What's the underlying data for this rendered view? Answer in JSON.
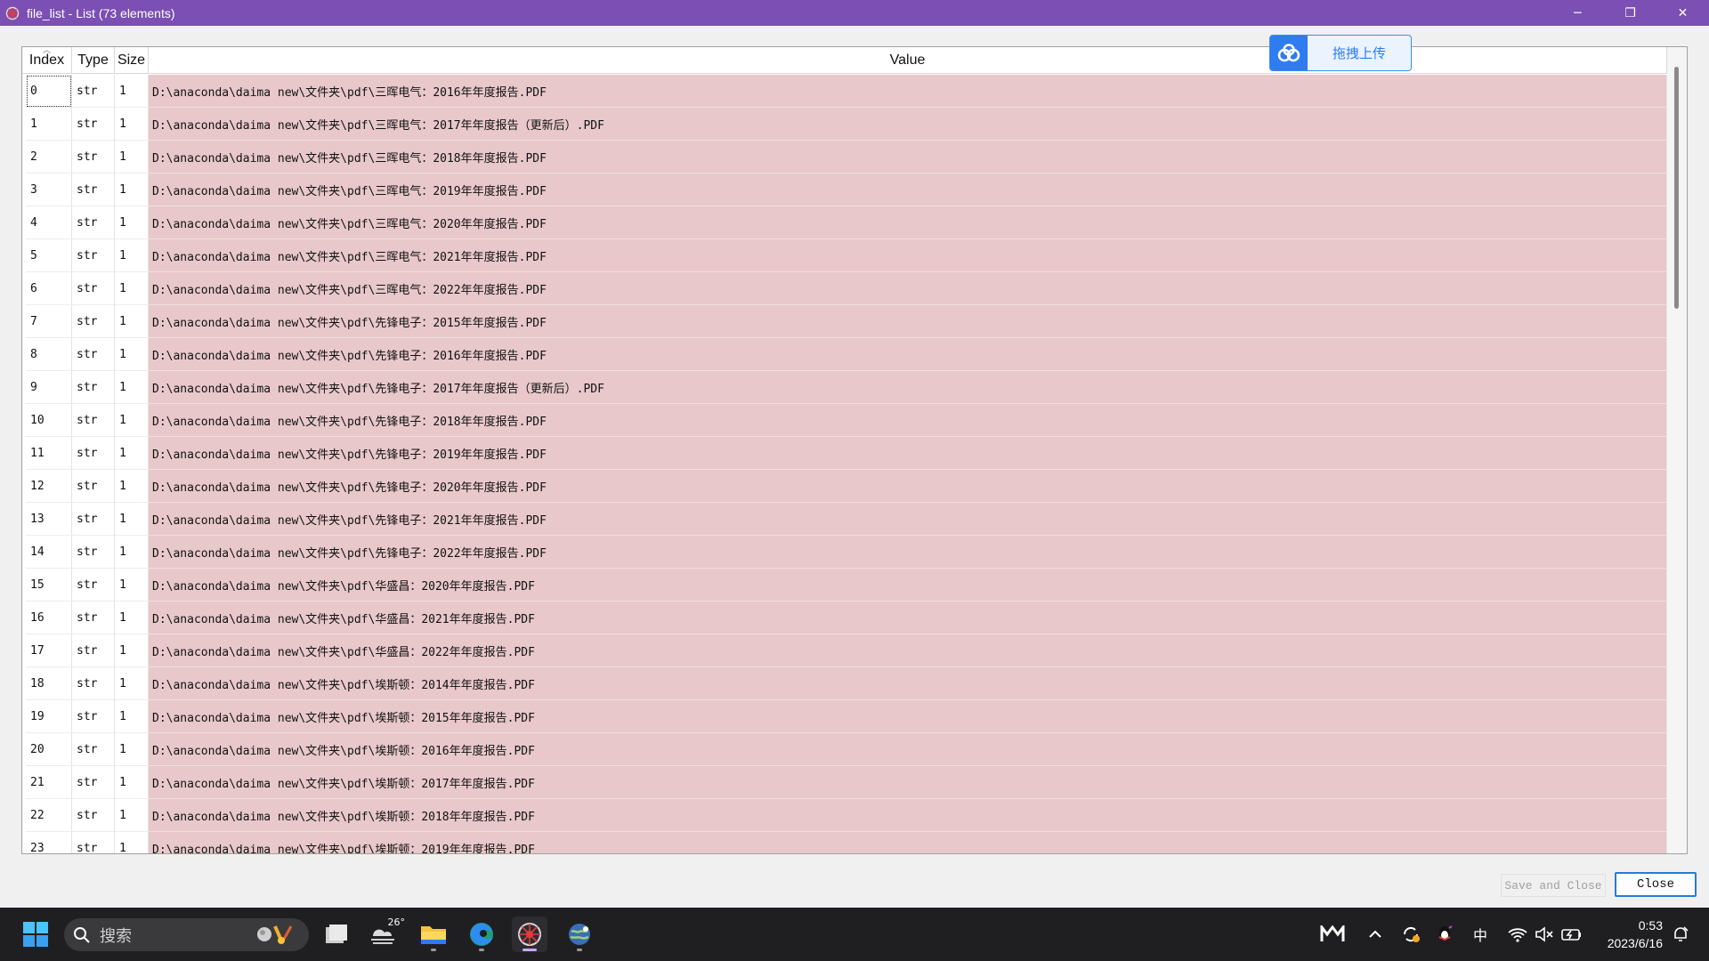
{
  "window": {
    "title": "file_list - List (73 elements)",
    "controls": {
      "minimize": "─",
      "restore": "❐",
      "close": "✕"
    }
  },
  "table": {
    "headers": {
      "index": "Index",
      "type": "Type",
      "size": "Size",
      "value": "Value"
    },
    "rows": [
      {
        "index": "0",
        "type": "str",
        "size": "1",
        "value": "D:\\anaconda\\daima new\\文件夹\\pdf\\三晖电气：2016年年度报告.PDF"
      },
      {
        "index": "1",
        "type": "str",
        "size": "1",
        "value": "D:\\anaconda\\daima new\\文件夹\\pdf\\三晖电气：2017年年度报告（更新后）.PDF"
      },
      {
        "index": "2",
        "type": "str",
        "size": "1",
        "value": "D:\\anaconda\\daima new\\文件夹\\pdf\\三晖电气：2018年年度报告.PDF"
      },
      {
        "index": "3",
        "type": "str",
        "size": "1",
        "value": "D:\\anaconda\\daima new\\文件夹\\pdf\\三晖电气：2019年年度报告.PDF"
      },
      {
        "index": "4",
        "type": "str",
        "size": "1",
        "value": "D:\\anaconda\\daima new\\文件夹\\pdf\\三晖电气：2020年年度报告.PDF"
      },
      {
        "index": "5",
        "type": "str",
        "size": "1",
        "value": "D:\\anaconda\\daima new\\文件夹\\pdf\\三晖电气：2021年年度报告.PDF"
      },
      {
        "index": "6",
        "type": "str",
        "size": "1",
        "value": "D:\\anaconda\\daima new\\文件夹\\pdf\\三晖电气：2022年年度报告.PDF"
      },
      {
        "index": "7",
        "type": "str",
        "size": "1",
        "value": "D:\\anaconda\\daima new\\文件夹\\pdf\\先锋电子：2015年年度报告.PDF"
      },
      {
        "index": "8",
        "type": "str",
        "size": "1",
        "value": "D:\\anaconda\\daima new\\文件夹\\pdf\\先锋电子：2016年年度报告.PDF"
      },
      {
        "index": "9",
        "type": "str",
        "size": "1",
        "value": "D:\\anaconda\\daima new\\文件夹\\pdf\\先锋电子：2017年年度报告（更新后）.PDF"
      },
      {
        "index": "10",
        "type": "str",
        "size": "1",
        "value": "D:\\anaconda\\daima new\\文件夹\\pdf\\先锋电子：2018年年度报告.PDF"
      },
      {
        "index": "11",
        "type": "str",
        "size": "1",
        "value": "D:\\anaconda\\daima new\\文件夹\\pdf\\先锋电子：2019年年度报告.PDF"
      },
      {
        "index": "12",
        "type": "str",
        "size": "1",
        "value": "D:\\anaconda\\daima new\\文件夹\\pdf\\先锋电子：2020年年度报告.PDF"
      },
      {
        "index": "13",
        "type": "str",
        "size": "1",
        "value": "D:\\anaconda\\daima new\\文件夹\\pdf\\先锋电子：2021年年度报告.PDF"
      },
      {
        "index": "14",
        "type": "str",
        "size": "1",
        "value": "D:\\anaconda\\daima new\\文件夹\\pdf\\先锋电子：2022年年度报告.PDF"
      },
      {
        "index": "15",
        "type": "str",
        "size": "1",
        "value": "D:\\anaconda\\daima new\\文件夹\\pdf\\华盛昌：2020年年度报告.PDF"
      },
      {
        "index": "16",
        "type": "str",
        "size": "1",
        "value": "D:\\anaconda\\daima new\\文件夹\\pdf\\华盛昌：2021年年度报告.PDF"
      },
      {
        "index": "17",
        "type": "str",
        "size": "1",
        "value": "D:\\anaconda\\daima new\\文件夹\\pdf\\华盛昌：2022年年度报告.PDF"
      },
      {
        "index": "18",
        "type": "str",
        "size": "1",
        "value": "D:\\anaconda\\daima new\\文件夹\\pdf\\埃斯顿：2014年年度报告.PDF"
      },
      {
        "index": "19",
        "type": "str",
        "size": "1",
        "value": "D:\\anaconda\\daima new\\文件夹\\pdf\\埃斯顿：2015年年度报告.PDF"
      },
      {
        "index": "20",
        "type": "str",
        "size": "1",
        "value": "D:\\anaconda\\daima new\\文件夹\\pdf\\埃斯顿：2016年年度报告.PDF"
      },
      {
        "index": "21",
        "type": "str",
        "size": "1",
        "value": "D:\\anaconda\\daima new\\文件夹\\pdf\\埃斯顿：2017年年度报告.PDF"
      },
      {
        "index": "22",
        "type": "str",
        "size": "1",
        "value": "D:\\anaconda\\daima new\\文件夹\\pdf\\埃斯顿：2018年年度报告.PDF"
      },
      {
        "index": "23",
        "type": "str",
        "size": "1",
        "value": "D:\\anaconda\\daima new\\文件夹\\pdf\\埃斯顿：2019年年度报告.PDF"
      }
    ]
  },
  "upload": {
    "label": "拖拽上传",
    "icon": "cloud-icon",
    "color": "#2f7bf0"
  },
  "buttons": {
    "save_close": "Save and Close",
    "close": "Close"
  },
  "taskbar": {
    "search_placeholder": "搜索",
    "weather_temp": "26°",
    "tray": {
      "ime": "中"
    },
    "clock": {
      "time": "0:53",
      "date": "2023/6/16"
    }
  },
  "colors": {
    "titlebar": "#7b4fb3",
    "value_cell": "#e8c8ca",
    "accent": "#2a7ad5",
    "taskbar": "#1f1f22"
  }
}
